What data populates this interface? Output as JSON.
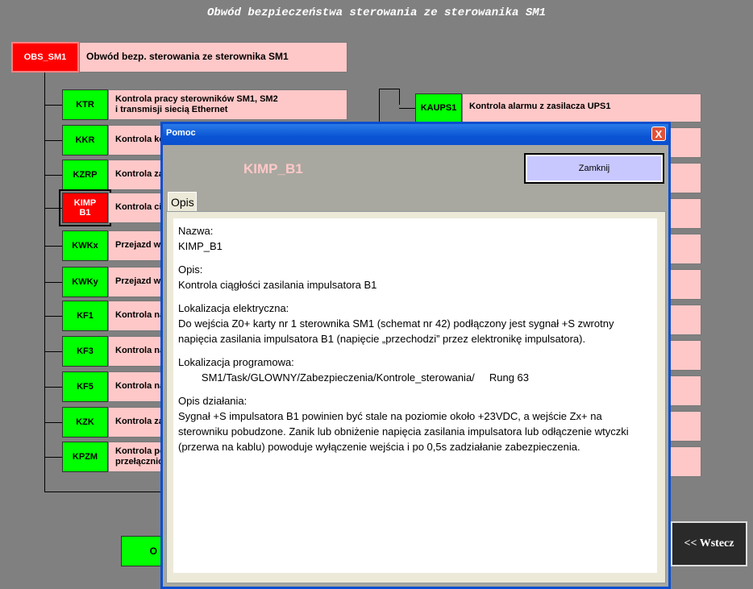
{
  "page_title": "Obwód bezpieczeństwa sterowania ze sterowanika SM1",
  "top_item": {
    "code": "OBS_SM1",
    "desc": "Obwód bezp. sterowania ze sterownika SM1"
  },
  "left_items": [
    {
      "code": "KTR",
      "desc": "Kontrola pracy sterowników SM1, SM2\ni transmisji siecią Ethernet"
    },
    {
      "code": "KKR",
      "desc": "Kontrola kon"
    },
    {
      "code": "KZRP",
      "desc": "Kontrola zał"
    },
    {
      "code": "KIMP\nB1",
      "desc": "Kontrola cią"
    },
    {
      "code": "KWKx",
      "desc": "Przejazd wy"
    },
    {
      "code": "KWKy",
      "desc": "Przejazd wy"
    },
    {
      "code": "KF1",
      "desc": "Kontrola nap"
    },
    {
      "code": "KF3",
      "desc": "Kontrola nap"
    },
    {
      "code": "KF5",
      "desc": "Kontrola nap"
    },
    {
      "code": "KZK",
      "desc": "Kontrola zad"
    },
    {
      "code": "KPZM",
      "desc": "Kontrola po\nprzełącznicy"
    }
  ],
  "right_item": {
    "code": "KAUPS1",
    "desc": "Kontrola alarmu z zasilacza UPS1"
  },
  "bottom_left_label": "O",
  "back_button": "<< Wstecz",
  "dialog": {
    "title": "Pomoc",
    "close_glyph": "X",
    "heading": "KIMP_B1",
    "close_button": "Zamknij",
    "tab": "Opis",
    "sections": [
      {
        "label": "Nazwa:",
        "text": "KIMP_B1"
      },
      {
        "label": "Opis:",
        "text": "Kontrola ciągłości zasilania impulsatora B1"
      },
      {
        "label": "Lokalizacja elektryczna:",
        "text": "Do wejścia Z0+ karty nr 1 sterownika SM1 (schemat nr 42) podłączony jest sygnał +S zwrotny napięcia zasilania impulsatora B1 (napięcie „przechodzi” przez elektronikę impulsatora)."
      },
      {
        "label": "Lokalizacja programowa:",
        "text": "        SM1/Task/GLOWNY/Zabezpieczenia/Kontrole_sterowania/     Rung 63"
      },
      {
        "label": "Opis działania:",
        "text": "Sygnał +S impulsatora B1 powinien być stale na poziomie około +23VDC, a wejście Zx+ na sterowniku pobudzone. Zanik lub obniżenie napięcia zasilania impulsatora lub odłączenie wtyczki (przerwa na kablu) powoduje wyłączenie wejścia i po 0,5s zadziałanie zabezpieczenia."
      }
    ]
  }
}
